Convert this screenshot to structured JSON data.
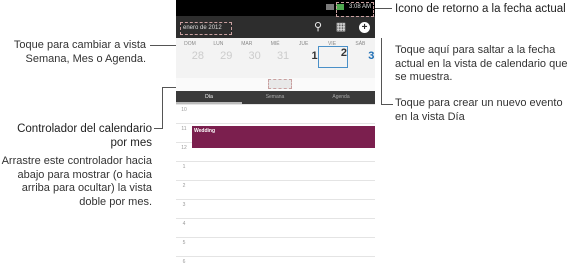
{
  "annotations": {
    "month_switch": "Toque para cambiar a vista Semana, Mes o Agenda.",
    "controller_title": "Controlador del calendario por mes",
    "controller_desc": "Arrastre este controlador hacia abajo para mostrar (o hacia arriba para ocultar) la vista doble por mes.",
    "return_title": "Icono de retorno a la fecha actual",
    "return_desc": "Toque aquí para saltar a la fecha actual en la vista de calendario que se muestra.",
    "create_desc": "Toque para crear un nuevo evento en la vista Día"
  },
  "status": {
    "time": "3:08 AM"
  },
  "actionbar": {
    "month_label": "enero de 2012",
    "icons": [
      "search-icon",
      "calendar-return-icon",
      "add-event-icon"
    ]
  },
  "week": {
    "days": [
      {
        "name": "DOM",
        "num": "28"
      },
      {
        "name": "LUN",
        "num": "29"
      },
      {
        "name": "MAR",
        "num": "30"
      },
      {
        "name": "MIÉ",
        "num": "31"
      },
      {
        "name": "JUE",
        "num": "1"
      },
      {
        "name": "VIE",
        "num": "2"
      },
      {
        "name": "SÁB",
        "num": "3"
      }
    ]
  },
  "tabs": [
    "Día",
    "Semana",
    "Agenda"
  ],
  "hours": [
    "10",
    "11",
    "12",
    "1",
    "2",
    "3",
    "4",
    "5",
    "6"
  ],
  "event": {
    "title": "Wedding"
  },
  "colors": {
    "event": "#7b1f4e",
    "actionbar": "#2d2d2d",
    "selected_day": "#1f6fb5"
  }
}
